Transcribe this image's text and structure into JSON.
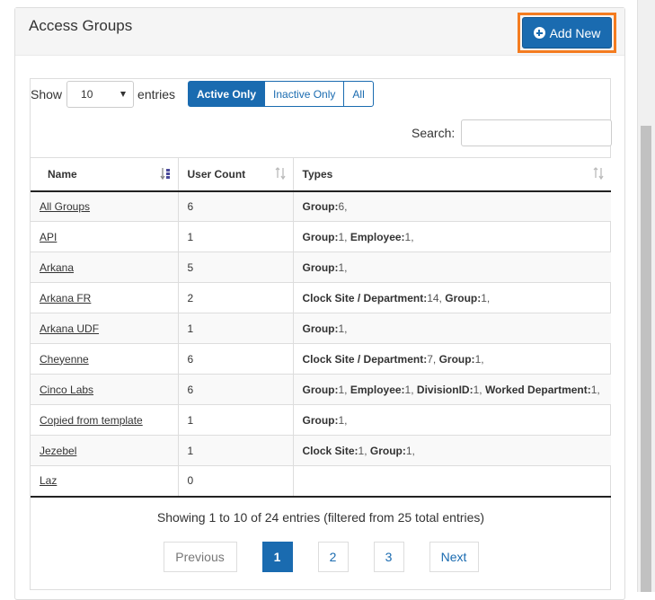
{
  "panel": {
    "title": "Access Groups",
    "add_button_label": "Add New"
  },
  "length": {
    "show_label": "Show",
    "selected": "10",
    "entries_label": "entries"
  },
  "filters": [
    {
      "label": "Active Only",
      "active": true
    },
    {
      "label": "Inactive Only",
      "active": false
    },
    {
      "label": "All",
      "active": false
    }
  ],
  "search": {
    "label": "Search:",
    "value": ""
  },
  "table": {
    "headers": [
      "Name",
      "User Count",
      "Types"
    ],
    "rows": [
      {
        "name": "All Groups",
        "count": "6",
        "types": [
          {
            "k": "Group:",
            "v": "6,"
          }
        ]
      },
      {
        "name": "API",
        "count": "1",
        "types": [
          {
            "k": "Group:",
            "v": "1,"
          },
          {
            "k": "Employee:",
            "v": "1,"
          }
        ]
      },
      {
        "name": "Arkana",
        "count": "5",
        "types": [
          {
            "k": "Group:",
            "v": "1,"
          }
        ]
      },
      {
        "name": "Arkana FR",
        "count": "2",
        "types": [
          {
            "k": "Clock Site / Department:",
            "v": "14,"
          },
          {
            "k": "Group:",
            "v": "1,"
          }
        ]
      },
      {
        "name": "Arkana UDF",
        "count": "1",
        "types": [
          {
            "k": "Group:",
            "v": "1,"
          }
        ]
      },
      {
        "name": "Cheyenne",
        "count": "6",
        "types": [
          {
            "k": "Clock Site / Department:",
            "v": "7,"
          },
          {
            "k": "Group:",
            "v": "1,"
          }
        ]
      },
      {
        "name": "Cinco Labs",
        "count": "6",
        "types": [
          {
            "k": "Group:",
            "v": "1,"
          },
          {
            "k": "Employee:",
            "v": "1,"
          },
          {
            "k": "DivisionID:",
            "v": "1,"
          },
          {
            "k": "Worked Department:",
            "v": "1,"
          }
        ]
      },
      {
        "name": "Copied from template",
        "count": "1",
        "types": [
          {
            "k": "Group:",
            "v": "1,"
          }
        ]
      },
      {
        "name": "Jezebel",
        "count": "1",
        "types": [
          {
            "k": "Clock Site:",
            "v": "1,"
          },
          {
            "k": "Group:",
            "v": "1,"
          }
        ]
      },
      {
        "name": "Laz",
        "count": "0",
        "types": []
      }
    ]
  },
  "info": "Showing 1 to 10 of 24 entries (filtered from 25 total entries)",
  "pagination": {
    "previous": "Previous",
    "pages": [
      "1",
      "2",
      "3"
    ],
    "current": "1",
    "next": "Next"
  },
  "colors": {
    "primary": "#1a6bb0",
    "highlight_outline": "#f47c20"
  }
}
